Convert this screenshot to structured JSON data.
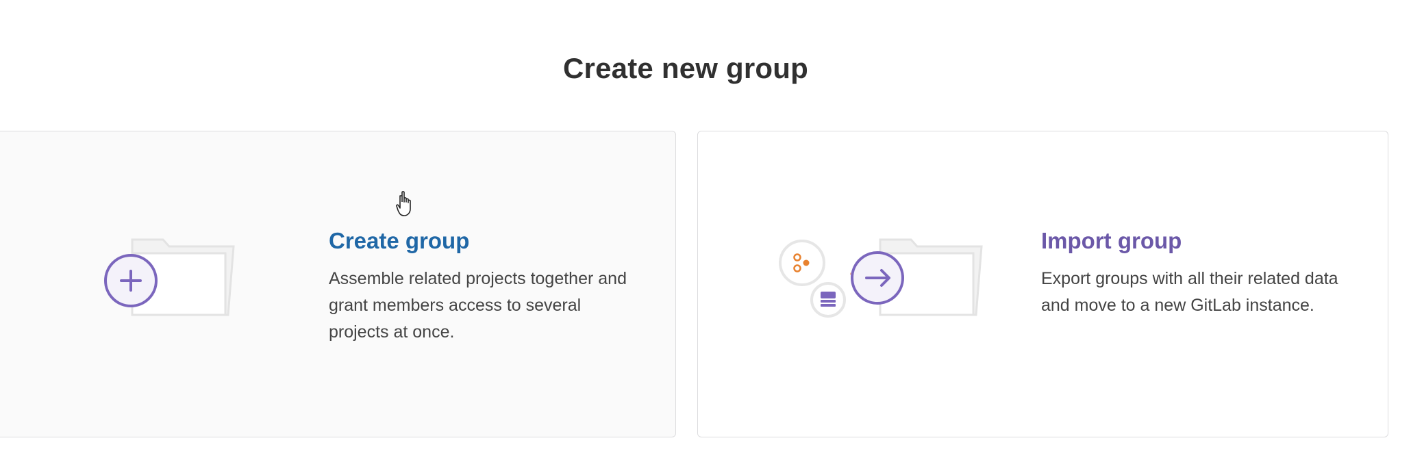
{
  "page": {
    "title": "Create new group"
  },
  "panels": {
    "create": {
      "heading": "Create group",
      "description": "Assemble related projects together and grant members access to several projects at once.",
      "illustration_icon": "folder-plus-icon"
    },
    "import": {
      "heading": "Import group",
      "description": "Export groups with all their related data and move to a new GitLab instance.",
      "illustration_icon": "folder-import-icon"
    }
  },
  "colors": {
    "create_heading": "#1f67a6",
    "import_heading": "#6b58a8",
    "accent_purple": "#7b66bd",
    "accent_orange": "#e8822f"
  }
}
